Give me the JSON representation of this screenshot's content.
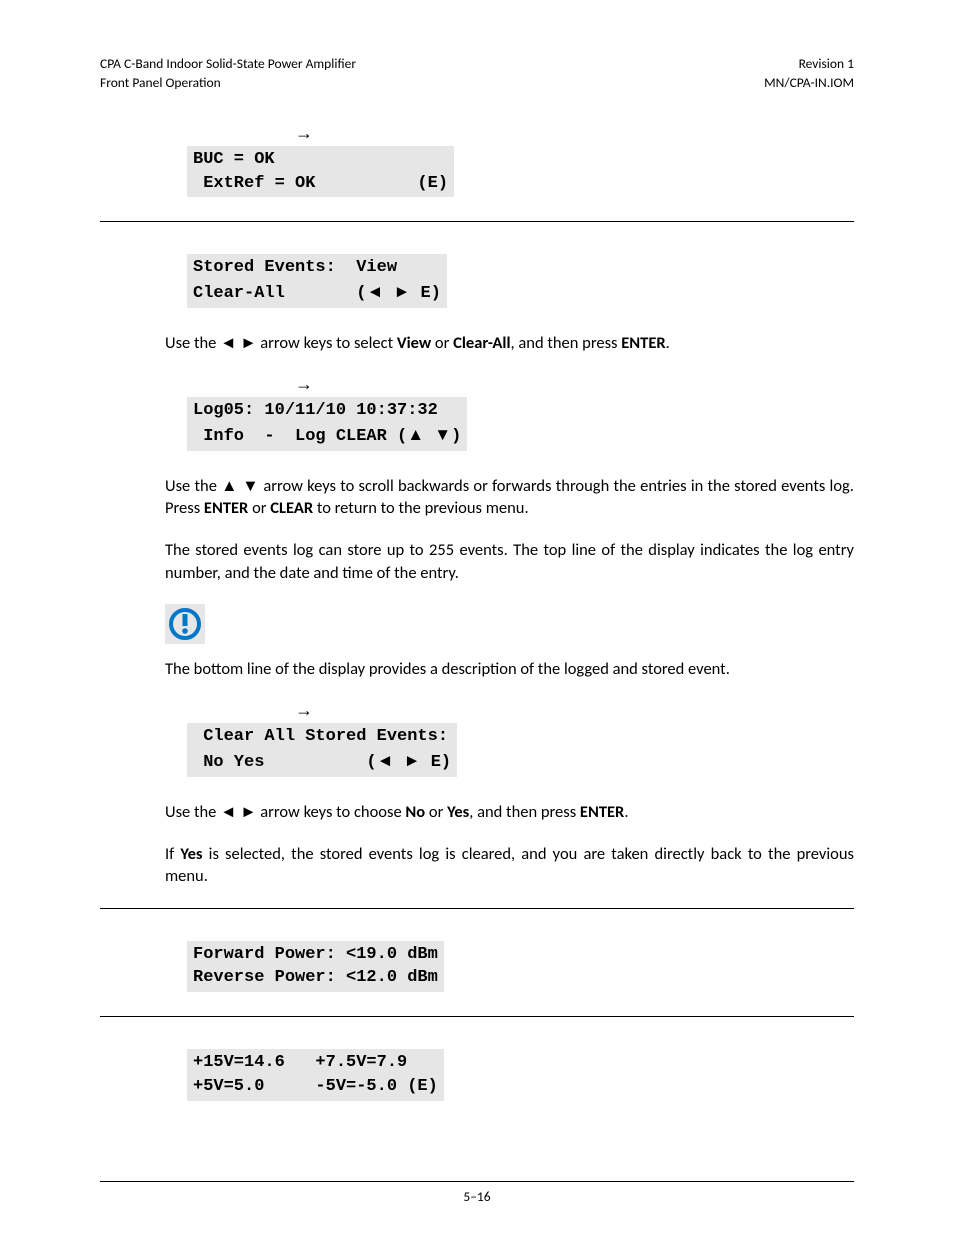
{
  "header": {
    "left_line1": "CPA C-Band Indoor Solid-State Power Amplifier",
    "left_line2": "Front Panel Operation",
    "right_line1": "Revision 1",
    "right_line2": "MN/CPA-IN.IOM"
  },
  "glyphs": {
    "right_arrow": "→",
    "left_tri": "◄",
    "right_tri": "►",
    "up_tri": "▲",
    "down_tri": "▼"
  },
  "displays": {
    "d1_l1": "BUC = OK",
    "d1_l2": " ExtRef = OK          (E)",
    "d2_l1": "Stored Events:  View",
    "d2_l2_a": "Clear-All       (",
    "d2_l2_b": " E)",
    "d3_l1": "Log05: 10/11/10 10:37:32",
    "d3_l2_a": " Info  -  Log CLEAR (",
    "d3_l2_b": ")",
    "d4_l1": " Clear All Stored Events:",
    "d4_l2_a": " No Yes          (",
    "d4_l2_b": " E)",
    "d5_l1": "Forward Power: <19.0 dBm",
    "d5_l2": "Reverse Power: <12.0 dBm",
    "d6_l1": "+15V=14.6   +7.5V=7.9",
    "d6_l2": "+5V=5.0     -5V=-5.0 (E)"
  },
  "paragraphs": {
    "p1_a": "Use the ",
    "p1_b": " arrow keys to select ",
    "p1_c": " or ",
    "p1_d": ", and then press ",
    "p1_e": ".",
    "p1_view": "View",
    "p1_clearall": "Clear-All",
    "p1_enter": "ENTER",
    "p2_a": "Use the ",
    "p2_b": " arrow keys to scroll backwards or forwards through the entries in the stored events log. Press ",
    "p2_c": " or ",
    "p2_d": " to return to the previous menu.",
    "p2_enter": "ENTER",
    "p2_clear": "CLEAR",
    "p3": "The stored events log can store up to 255 events. The top line of the display indicates the log entry number, and the date and time of the entry.",
    "p4": "The bottom line of the display provides a description of the logged and stored event.",
    "p5_a": "Use the ",
    "p5_b": " arrow keys to choose ",
    "p5_c": " or ",
    "p5_d": ", and then press ",
    "p5_e": ".",
    "p5_no": "No",
    "p5_yes": "Yes",
    "p5_enter": "ENTER",
    "p6_a": "If ",
    "p6_b": " is selected, the stored events log is cleared, and you are taken directly back to the previous menu.",
    "p6_yes": "Yes"
  },
  "footer": {
    "page_num": "5–16"
  }
}
